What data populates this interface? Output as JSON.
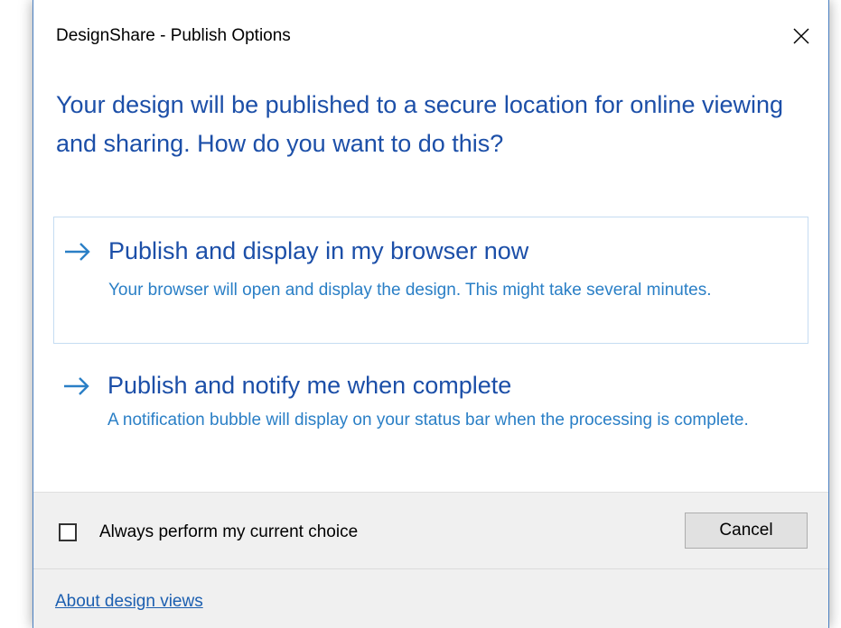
{
  "dialog": {
    "title": "DesignShare - Publish Options",
    "instruction": "Your design will be published to a secure location for online viewing and sharing.  How do you want to do this?"
  },
  "options": [
    {
      "title": "Publish and display in my browser now",
      "description": "Your browser will open and display the design. This might take several minutes.",
      "icon": "right-arrow-icon"
    },
    {
      "title": "Publish and notify me when complete",
      "description": "A notification bubble will display on your status bar when the processing is complete.",
      "icon": "right-arrow-icon"
    }
  ],
  "footer": {
    "checkbox_label": "Always perform my current choice",
    "checkbox_checked": false,
    "cancel_label": "Cancel",
    "link_text": "About design views"
  },
  "colors": {
    "instruction_text": "#1c4fa8",
    "description_text": "#2a7fc6",
    "hover_border": "#c5dcf2",
    "footer_background": "#f0f0f0",
    "link": "#1c5fb0",
    "window_border": "#4a7fc1"
  }
}
